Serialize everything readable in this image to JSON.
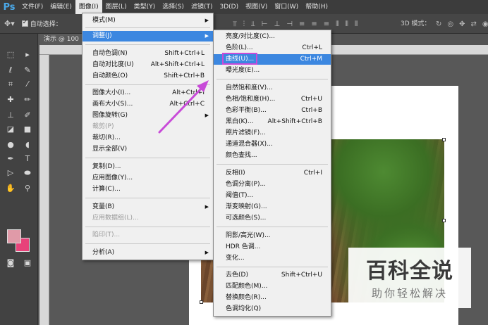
{
  "menubar": {
    "logo": "Ps",
    "items": [
      "文件(F)",
      "编辑(E)",
      "图像(I)",
      "图层(L)",
      "类型(Y)",
      "选择(S)",
      "滤镜(T)",
      "3D(D)",
      "视图(V)",
      "窗口(W)",
      "帮助(H)"
    ],
    "active_index": 2
  },
  "options": {
    "auto_select_label": "自动选择：",
    "mode_label": "3D 模式："
  },
  "document": {
    "tab_title": "演示 @ 100"
  },
  "image_menu": {
    "items": [
      {
        "label": "模式(M)",
        "shortcut": "",
        "submenu": true,
        "disabled": false
      },
      {
        "label": "调整(J)",
        "shortcut": "",
        "submenu": true,
        "disabled": false,
        "highlighted": true
      },
      {
        "label": "自动色调(N)",
        "shortcut": "Shift+Ctrl+L",
        "disabled": false
      },
      {
        "label": "自动对比度(U)",
        "shortcut": "Alt+Shift+Ctrl+L",
        "disabled": false
      },
      {
        "label": "自动颜色(O)",
        "shortcut": "Shift+Ctrl+B",
        "disabled": false
      },
      {
        "label": "图像大小(I)...",
        "shortcut": "Alt+Ctrl+I",
        "disabled": false
      },
      {
        "label": "画布大小(S)...",
        "shortcut": "Alt+Ctrl+C",
        "disabled": false
      },
      {
        "label": "图像旋转(G)",
        "shortcut": "",
        "submenu": true,
        "disabled": false
      },
      {
        "label": "裁剪(P)",
        "shortcut": "",
        "disabled": true
      },
      {
        "label": "裁切(R)...",
        "shortcut": "",
        "disabled": false
      },
      {
        "label": "显示全部(V)",
        "shortcut": "",
        "disabled": false
      },
      {
        "label": "复制(D)...",
        "shortcut": "",
        "disabled": false
      },
      {
        "label": "应用图像(Y)...",
        "shortcut": "",
        "disabled": false
      },
      {
        "label": "计算(C)...",
        "shortcut": "",
        "disabled": false
      },
      {
        "label": "变量(B)",
        "shortcut": "",
        "submenu": true,
        "disabled": false
      },
      {
        "label": "应用数据组(L)...",
        "shortcut": "",
        "disabled": true
      },
      {
        "label": "陷印(T)...",
        "shortcut": "",
        "disabled": true
      },
      {
        "label": "分析(A)",
        "shortcut": "",
        "submenu": true,
        "disabled": false
      }
    ]
  },
  "adjust_menu": {
    "items": [
      {
        "label": "亮度/对比度(C)...",
        "shortcut": ""
      },
      {
        "label": "色阶(L)...",
        "shortcut": "Ctrl+L"
      },
      {
        "label": "曲线(U)...",
        "shortcut": "Ctrl+M",
        "highlighted": true
      },
      {
        "label": "曝光度(E)...",
        "shortcut": ""
      },
      {
        "label": "自然饱和度(V)...",
        "shortcut": ""
      },
      {
        "label": "色相/饱和度(H)...",
        "shortcut": "Ctrl+U"
      },
      {
        "label": "色彩平衡(B)...",
        "shortcut": "Ctrl+B"
      },
      {
        "label": "黑白(K)...",
        "shortcut": "Alt+Shift+Ctrl+B"
      },
      {
        "label": "照片滤镜(F)...",
        "shortcut": ""
      },
      {
        "label": "通道混合器(X)...",
        "shortcut": ""
      },
      {
        "label": "颜色查找...",
        "shortcut": ""
      },
      {
        "label": "反相(I)",
        "shortcut": "Ctrl+I"
      },
      {
        "label": "色调分离(P)...",
        "shortcut": ""
      },
      {
        "label": "阈值(T)...",
        "shortcut": ""
      },
      {
        "label": "渐变映射(G)...",
        "shortcut": ""
      },
      {
        "label": "可选颜色(S)...",
        "shortcut": ""
      },
      {
        "label": "阴影/高光(W)...",
        "shortcut": ""
      },
      {
        "label": "HDR 色调...",
        "shortcut": ""
      },
      {
        "label": "变化...",
        "shortcut": ""
      },
      {
        "label": "去色(D)",
        "shortcut": "Shift+Ctrl+U"
      },
      {
        "label": "匹配颜色(M)...",
        "shortcut": ""
      },
      {
        "label": "替换颜色(R)...",
        "shortcut": ""
      },
      {
        "label": "色调均化(Q)",
        "shortcut": ""
      }
    ]
  },
  "watermark": {
    "title": "百科全说",
    "subtitle": "助你轻松解决"
  },
  "colors": {
    "foreground": "#e09aa8",
    "background": "#e8427a",
    "menu_highlight": "#3c87e0",
    "annotation": "#c84bd8"
  }
}
